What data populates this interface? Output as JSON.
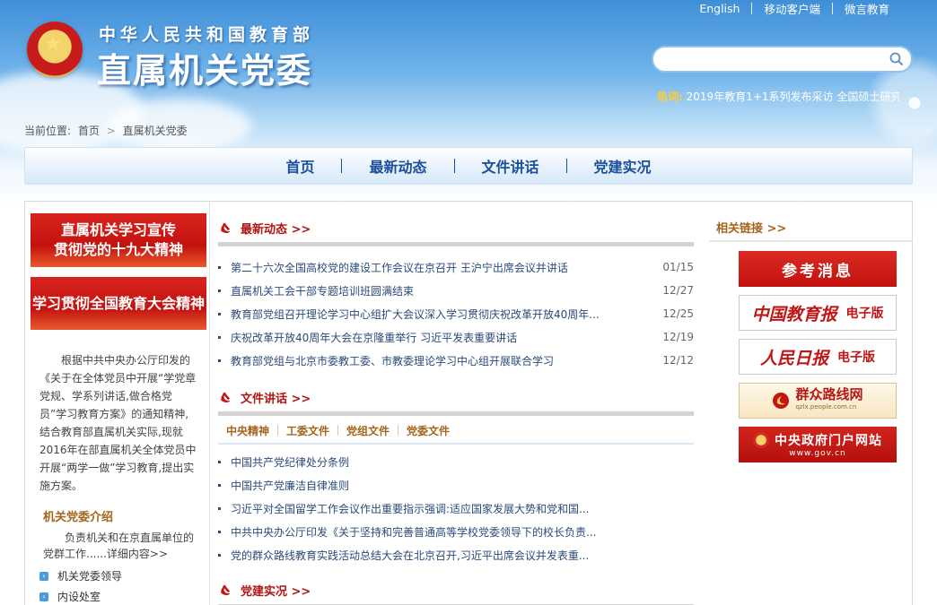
{
  "header": {
    "top_links": [
      "English",
      "移动客户端",
      "微言教育"
    ],
    "org_name": "中华人民共和国教育部",
    "site_name": "直属机关党委",
    "search_placeholder": "",
    "hot_label": "热词:",
    "hot_text": "2019年教育1+1系列发布采访  全国硕士研究"
  },
  "breadcrumb": {
    "label": "当前位置:",
    "home": "首页",
    "separator": ">",
    "current": "直属机关党委"
  },
  "nav": [
    "首页",
    "最新动态",
    "文件讲话",
    "党建实况"
  ],
  "left": {
    "banner1_line1": "直属机关学习宣传",
    "banner1_line2": "贯彻党的十九大精神",
    "banner2": "学习贯彻全国教育大会精神",
    "intro": "根据中共中央办公厅印发的《关于在全体党员中开展“学党章党规、学系列讲话,做合格党员”学习教育方案》的通知精神,结合教育部直属机关实际,现就2016年在部直属机关全体党员中开展“两学一做”学习教育,提出实施方案。",
    "section_title": "机关党委介绍",
    "section_text": "负责机关和在京直属单位的党群工作......详细内容>>",
    "links": [
      "机关党委领导",
      "内设处室"
    ]
  },
  "middle": {
    "latest": {
      "title": "最新动态 >>",
      "items": [
        {
          "text": "第二十六次全国高校党的建设工作会议在京召开 王沪宁出席会议并讲话",
          "date": "01/15"
        },
        {
          "text": "直属机关工会干部专题培训班圆满结束",
          "date": "12/27"
        },
        {
          "text": "教育部党组召开理论学习中心组扩大会议深入学习贯彻庆祝改革开放40周年...",
          "date": "12/25"
        },
        {
          "text": "庆祝改革开放40周年大会在京隆重举行 习近平发表重要讲话",
          "date": "12/19"
        },
        {
          "text": "教育部党组与北京市委教工委、市教委理论学习中心组开展联合学习",
          "date": "12/12"
        }
      ]
    },
    "docs": {
      "title": "文件讲话 >>",
      "tabs": [
        "中央精神",
        "工委文件",
        "党组文件",
        "党委文件"
      ],
      "items": [
        "中国共产党纪律处分条例",
        "中国共产党廉洁自律准则",
        "习近平对全国留学工作会议作出重要指示强调:适应国家发展大势和党和国...",
        "中共中央办公厅印发《关于坚持和完善普通高等学校党委领导下的校长负责...",
        "党的群众路线教育实践活动总结大会在北京召开,习近平出席会议并发表重..."
      ]
    },
    "party": {
      "title": "党建实况 >>"
    }
  },
  "right": {
    "title": "相关链接 >>",
    "links": {
      "cankao": "参考消息",
      "jyb_a": "中国教育报",
      "jyb_b": "电子版",
      "rmrb_a": "人民日报",
      "rmrb_b": "电子版",
      "qzlx_a": "群众路线网",
      "qzlx_b": "qzlx.people.com.cn",
      "gov_a": "中央政府门户网站",
      "gov_b": "www.gov.cn"
    }
  },
  "colors": {
    "nav_text": "#1a4f9a",
    "accent_red": "#c4120f",
    "section_brown": "#a5651c",
    "news_blue": "#2b4a7a"
  }
}
